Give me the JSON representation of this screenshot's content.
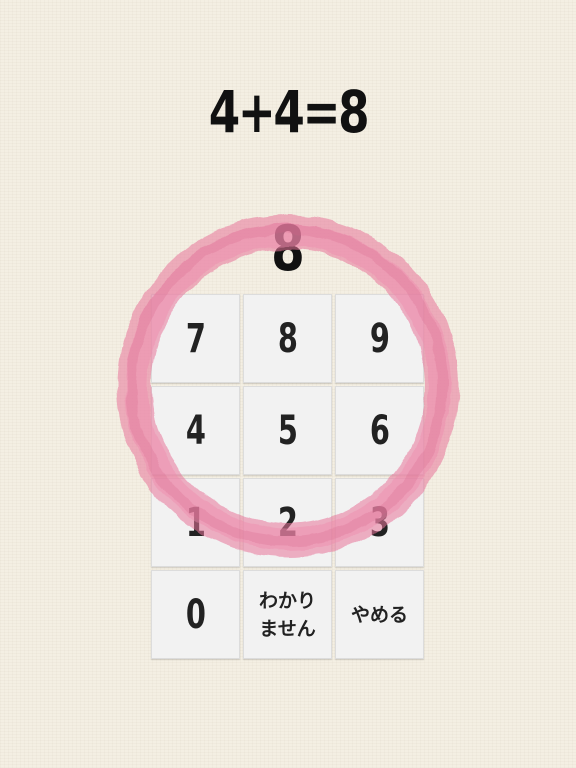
{
  "question": {
    "equation": "4+4=8",
    "entered_answer": "8"
  },
  "keypad": {
    "keys": [
      {
        "label": "7",
        "kind": "digit"
      },
      {
        "label": "8",
        "kind": "digit"
      },
      {
        "label": "9",
        "kind": "digit"
      },
      {
        "label": "4",
        "kind": "digit"
      },
      {
        "label": "5",
        "kind": "digit"
      },
      {
        "label": "6",
        "kind": "digit"
      },
      {
        "label": "1",
        "kind": "digit"
      },
      {
        "label": "2",
        "kind": "digit"
      },
      {
        "label": "3",
        "kind": "digit"
      },
      {
        "label": "0",
        "kind": "digit"
      },
      {
        "label": "わかり\nません",
        "kind": "text"
      },
      {
        "label": "やめる",
        "kind": "text"
      }
    ]
  },
  "feedback": {
    "result": "correct",
    "icon": "correct-circle-icon",
    "color": "#e8749a"
  },
  "colors": {
    "background": "#f4efe3",
    "key_background": "#f2f2f2",
    "text": "#111111"
  }
}
